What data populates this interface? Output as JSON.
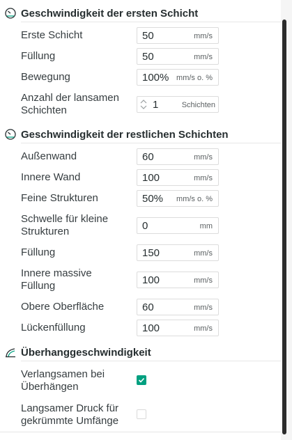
{
  "sections": [
    {
      "title": "Geschwindigkeit der ersten Schicht",
      "icon": "speedometer-icon",
      "rows": [
        {
          "label": "Erste Schicht",
          "value": "50",
          "unit": "mm/s"
        },
        {
          "label": "Füllung",
          "value": "50",
          "unit": "mm/s"
        },
        {
          "label": "Bewegung",
          "value": "100%",
          "unit": "mm/s o. %"
        },
        {
          "label": "Anzahl der lansamen Schichten",
          "value": "1",
          "unit": "Schichten"
        }
      ]
    },
    {
      "title": "Geschwindigkeit der restlichen Schichten",
      "icon": "speedometer-icon",
      "rows": [
        {
          "label": "Außenwand",
          "value": "60",
          "unit": "mm/s"
        },
        {
          "label": "Innere Wand",
          "value": "100",
          "unit": "mm/s"
        },
        {
          "label": "Feine Strukturen",
          "value": "50%",
          "unit": "mm/s o. %"
        },
        {
          "label": "Schwelle für kleine Strukturen",
          "value": "0",
          "unit": "mm"
        },
        {
          "label": "Füllung",
          "value": "150",
          "unit": "mm/s"
        },
        {
          "label": "Innere massive Füllung",
          "value": "100",
          "unit": "mm/s"
        },
        {
          "label": "Obere Oberfläche",
          "value": "60",
          "unit": "mm/s"
        },
        {
          "label": "Lückenfüllung",
          "value": "100",
          "unit": "mm/s"
        }
      ]
    },
    {
      "title": "Überhanggeschwindigkeit",
      "icon": "overhang-icon",
      "rows": [
        {
          "label": "Verlangsamen bei Überhängen",
          "checked": true
        },
        {
          "label": "Langsamer Druck für gekrümmte Umfänge",
          "checked": false
        }
      ]
    }
  ],
  "colors": {
    "accent": "#00a080",
    "text": "#262e30",
    "border": "#dcdcdc"
  }
}
